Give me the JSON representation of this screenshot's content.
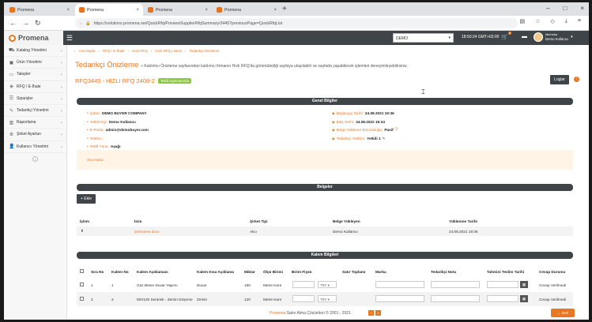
{
  "browser": {
    "tabs": [
      {
        "label": "Promena",
        "active": false
      },
      {
        "label": "Promena",
        "active": true
      },
      {
        "label": "Promena",
        "active": false
      },
      {
        "label": "Promena",
        "active": false
      }
    ],
    "url": "https://solutions.promena.net/QuickRfq/PreviewSupplierRfqSummary/3445?previousPage=QuickRfqList"
  },
  "header": {
    "logo": "Promena",
    "company": "DEMO",
    "clock": "18:50:24 GMT+03:00",
    "cart_badge": "0",
    "greeting": "Merhaba",
    "user_name": "Demo Kullanıcı"
  },
  "sidebar": {
    "items": [
      {
        "label": "Katalog Yönetimi",
        "icon": "cart-icon"
      },
      {
        "label": "Ürün Yönetimi",
        "icon": "box-icon"
      },
      {
        "label": "Talepler",
        "icon": "document-icon"
      },
      {
        "label": "RFQ / E-İhale",
        "icon": "tag-icon"
      },
      {
        "label": "Siparişler",
        "icon": "list-icon"
      },
      {
        "label": "Tedarikçi Yönetimi",
        "icon": "supplier-icon"
      },
      {
        "label": "Raporlama",
        "icon": "chart-icon"
      },
      {
        "label": "Şirket Ayarları",
        "icon": "gear-icon"
      },
      {
        "label": "Kullanıcı Yönetimi",
        "icon": "users-icon"
      }
    ]
  },
  "breadcrumb": [
    "Ana Sayfa",
    "RFQ / E-İhale",
    "Hızlı RFQ",
    "Hızlı RFQ Listesi",
    "Tedarikçi Önizleme"
  ],
  "page": {
    "title": "Tedarikçi Önizleme",
    "subtitle": "» Katılımcı Önizleme sayfasından katılımcı firmanın Hızlı RFQ'da görüntülediği sayfaya ulaşılabilir ve sayfada yapabilecek işlemleri deneyimleyebilirsiniz.",
    "rfq_code": "RFQ3445 - HIZLI RFQ 2408-2",
    "status": "Teklif Aşamasında",
    "logs_button": "Loglar",
    "info_icon": "i"
  },
  "general": {
    "header": "Genel Bilgiler",
    "left": [
      {
        "label": "Şirket:",
        "value": "DEMO BUYER COMPANY"
      },
      {
        "label": "Yetkili Kişi:",
        "value": "Demo Kullanıcı"
      },
      {
        "label": "E-Posta:",
        "value": "admin@demobuyer.com"
      },
      {
        "label": "Telefon :",
        "value": ""
      },
      {
        "label": "Teklif Yönü:",
        "value": "Aşağı"
      }
    ],
    "right": [
      {
        "label": "Başlangıç Tarihi:",
        "value": "24.08.2021 19:36"
      },
      {
        "label": "Bitiş Tarihi:",
        "value": "24.08.2022 19:24"
      },
      {
        "label": "Belge Yükleme Zorunluluğu:",
        "value": "Pasif"
      },
      {
        "label": "Tedarikçi Yetkilisi:",
        "value": "Yetkili 1"
      }
    ],
    "note_label": "Alıcı Notu:"
  },
  "documents": {
    "header": "Belgeler",
    "add_button": "+ Ekle",
    "columns": [
      "İşlem",
      "İsim",
      "Şirket Tipi",
      "Belge Yükleyen",
      "Yüklenme Tarihi"
    ],
    "rows": [
      {
        "name": "Şartname.docx",
        "company_type": "Alıcı",
        "uploader": "Demo Kullanıcı",
        "date": "24.08.2021 19:36"
      }
    ]
  },
  "items": {
    "header": "Kalem Bilgileri",
    "columns": [
      "Sıra No",
      "Kalem No",
      "Kalem Açıklaması",
      "Kalem Kısa Açıklama",
      "Miktar",
      "Ölçü Birimi",
      "Birim Fiyatı",
      "Satır Toplamı",
      "Marka",
      "Tedarikçi Notu",
      "Tahmini Teslim Tarihi",
      "Cevap Durumu"
    ],
    "rows": [
      {
        "seq": "1",
        "item_no": "1",
        "desc": "Gaz Beton Duvar Yapımı",
        "short": "Duvar",
        "qty": "180",
        "unit": "Metre Kare",
        "currency": "TRY",
        "status": "Cevap Verilmedi"
      },
      {
        "seq": "2",
        "item_no": "2",
        "desc": "60X120 Seramik - Zemin Döşeme",
        "short": "Zemin",
        "qty": "120",
        "unit": "Metre Kare",
        "currency": "TRY",
        "status": "Cevap Verilmedi"
      }
    ]
  },
  "footer": {
    "brand": "Promena",
    "text": "Satın Alma Çözümleri © 2001 - 2021",
    "back_button": "Geri"
  },
  "colors": {
    "accent": "#e87722",
    "dark": "#3f4448",
    "success": "#8dc63f"
  }
}
